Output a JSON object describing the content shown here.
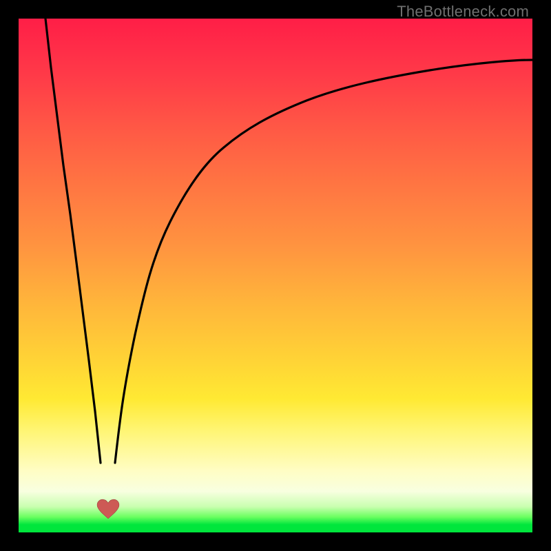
{
  "watermark": "TheBottleneck.com",
  "chart_data": {
    "type": "line",
    "title": "",
    "xlabel": "",
    "ylabel": "",
    "xlim": [
      0,
      100
    ],
    "ylim": [
      0,
      100
    ],
    "series": [
      {
        "name": "left-branch",
        "x": [
          5.2,
          6.3,
          7.5,
          8.7,
          10.0,
          11.2,
          12.4,
          13.7,
          14.9,
          16.0
        ],
        "values": [
          100,
          90.5,
          81.0,
          71.5,
          62.0,
          52.5,
          43.0,
          33.5,
          23.5,
          13.5
        ]
      },
      {
        "name": "right-branch",
        "x": [
          18.7,
          20.0,
          22.7,
          25.5,
          29.5,
          34.0,
          40.0,
          47.0,
          56.0,
          67.0,
          80.0,
          100.0
        ],
        "values": [
          13.5,
          24.0,
          38.5,
          50.0,
          60.5,
          68.5,
          75.0,
          80.0,
          84.0,
          87.3,
          89.7,
          92.0
        ]
      }
    ],
    "marker": {
      "name": "optimal-point-heart",
      "x": 17.4,
      "y": 4.5,
      "color": "#cd5a55"
    },
    "background": {
      "type": "vertical-gradient",
      "stops": [
        {
          "pos": 0.0,
          "color": "#ff1e47"
        },
        {
          "pos": 0.55,
          "color": "#ffb43b"
        },
        {
          "pos": 0.8,
          "color": "#fff572"
        },
        {
          "pos": 0.95,
          "color": "#c9ffb0"
        },
        {
          "pos": 1.0,
          "color": "#00e63c"
        }
      ]
    }
  },
  "colors": {
    "frame": "#000000",
    "curve": "#000000",
    "marker": "#cd5a55",
    "watermark": "#6f6f6f"
  }
}
